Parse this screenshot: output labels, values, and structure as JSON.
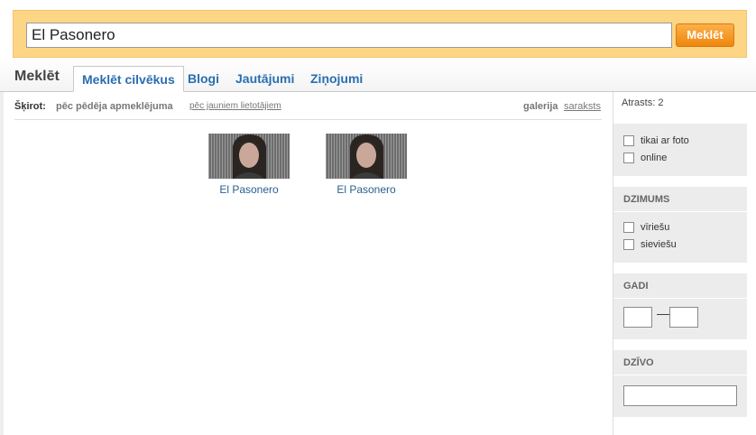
{
  "search": {
    "value": "El Pasonero",
    "button_label": "Meklēt"
  },
  "section_title": "Meklēt",
  "tabs": [
    {
      "label": "Meklēt cilvēkus",
      "active": true
    },
    {
      "label": "Blogi",
      "active": false
    },
    {
      "label": "Jautājumi",
      "active": false
    },
    {
      "label": "Ziņojumi",
      "active": false
    }
  ],
  "sort": {
    "label": "Šķirot:",
    "active_option": "pēc pēdēja apmeklējuma",
    "other_option": "pēc jauniem lietotājiem",
    "view_gallery": "galerija",
    "view_list": "saraksts"
  },
  "results": [
    {
      "name": "El Pasonero"
    },
    {
      "name": "El Pasonero"
    }
  ],
  "sidebar": {
    "found_text": "Atrasts: 2",
    "filters": [
      {
        "label": "tikai ar foto"
      },
      {
        "label": "online"
      }
    ],
    "gender": {
      "title": "DZIMUMS",
      "options": [
        {
          "label": "vīriešu"
        },
        {
          "label": "sieviešu"
        }
      ]
    },
    "age": {
      "title": "GADI",
      "separator": "—"
    },
    "city": {
      "title": "DZĪVO"
    }
  }
}
